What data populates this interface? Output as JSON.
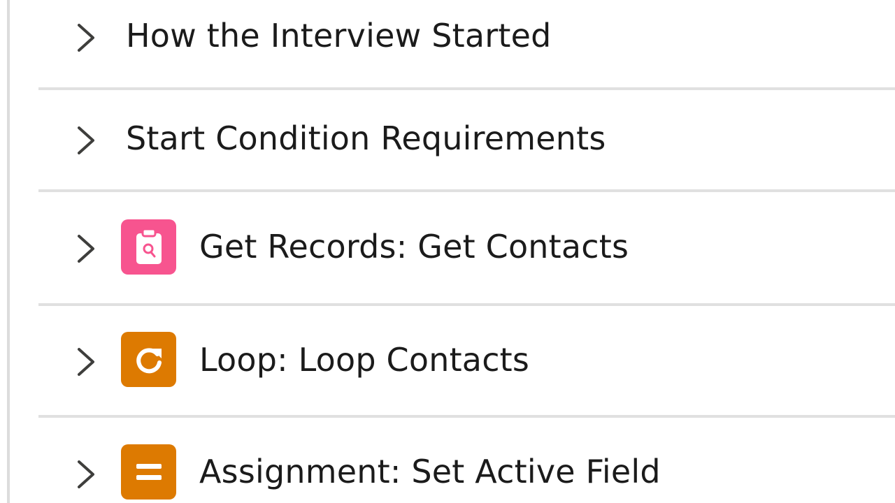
{
  "colors": {
    "get_records": "#f7548f",
    "loop": "#dd7a01",
    "assignment": "#dd7a01",
    "divider": "#e0e0e0",
    "text": "#1b1b1b",
    "chevron": "#3e3e3c"
  },
  "rows": [
    {
      "label": "How the Interview Started",
      "icon": null
    },
    {
      "label": "Start Condition Requirements",
      "icon": null
    },
    {
      "label": "Get Records: Get Contacts",
      "icon": "get-records-icon"
    },
    {
      "label": "Loop: Loop Contacts",
      "icon": "loop-icon"
    },
    {
      "label": "Assignment: Set Active Field",
      "icon": "assignment-icon"
    }
  ]
}
